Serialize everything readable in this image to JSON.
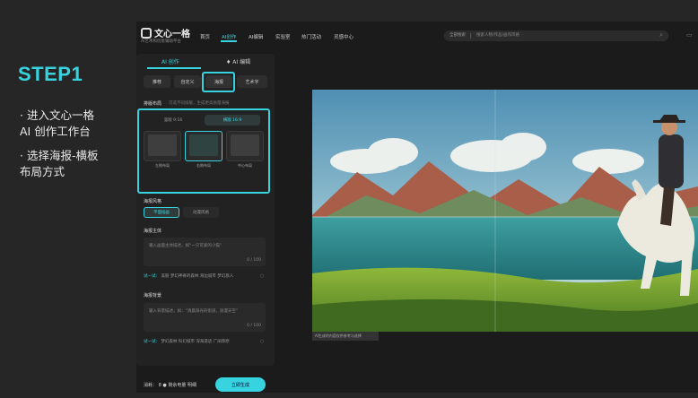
{
  "slide": {
    "step_title": "STEP1",
    "instruction_1_line1": "· 进入文心一格",
    "instruction_1_line2": "AI 创作工作台",
    "instruction_2_line1": "· 选择海报-横板",
    "instruction_2_line2": "布局方式"
  },
  "app": {
    "logo_title": "文心一格",
    "logo_subtitle": "AI艺术和创意辅助平台",
    "nav": [
      "首页",
      "AI创作",
      "AI编辑",
      "实验室",
      "热门活动",
      "灵感中心"
    ],
    "nav_active_index": 1,
    "search_scope": "全部搜索",
    "search_placeholder": "搜索人物/作品/画作风格",
    "panel_tabs": [
      "AI 创作",
      "AI 编辑"
    ],
    "modes": [
      "推荐",
      "自定义",
      "海报",
      "艺术字"
    ],
    "layout_section_title": "排版布局",
    "layout_section_sub": "可选不同排版，生成更高质量海报",
    "orientation_options": [
      "竖版 9:16",
      "横版 16:9"
    ],
    "layout_options": [
      "左侧布局",
      "右侧布局",
      "中心布局"
    ],
    "style_section_title": "海报风格",
    "style_options": [
      "平面插画",
      "动漫风格"
    ],
    "subject_section_title": "海报主体",
    "subject_placeholder": "输入画面主体描述，如“一只可爱的小猫”",
    "subject_count": "0 / 100",
    "subject_tags_prefix": "试一试：",
    "subject_tags": [
      "美丽",
      "梦幻神奇的森林",
      "海边城市",
      "梦幻旅人"
    ],
    "background_section_title": "海报背景",
    "background_placeholder": "输入背景描述，如：“清晨阳光的街道，浪漫天空”",
    "background_count": "0 / 100",
    "background_tags_prefix": "试一试：",
    "background_tags": [
      "梦幻森林",
      "科幻城市",
      "深海遗迹",
      "广阔草原"
    ],
    "cost_label": "消耗：",
    "cost_value": "8",
    "balance_label": "剩余电量",
    "detail_label": "明细",
    "generate_button": "立即生成",
    "canvas_caption": "AI生成的内容仅供参考与选择"
  },
  "colors": {
    "accent": "#37d4e0",
    "background": "#262626",
    "app_bg": "#1b1b1b",
    "panel_bg": "#222222"
  }
}
